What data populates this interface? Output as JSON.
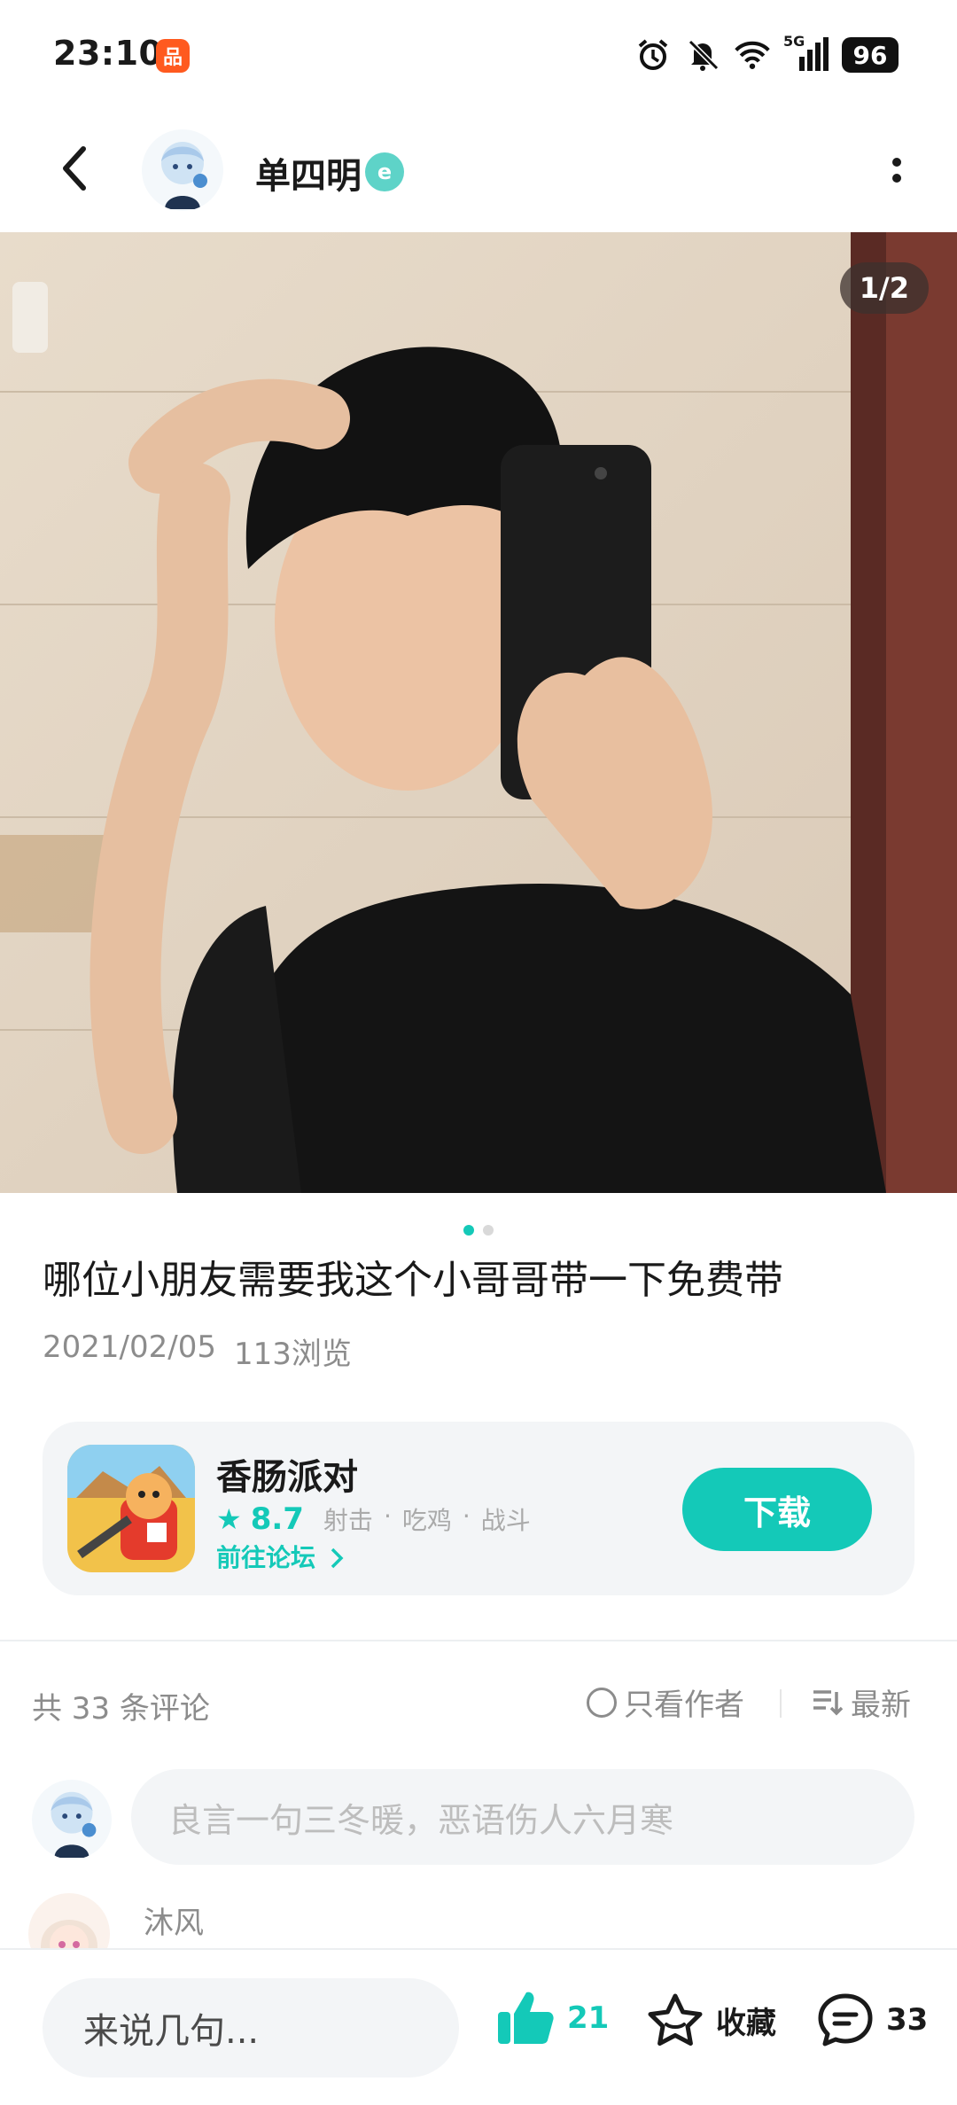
{
  "status_bar": {
    "time": "23:10",
    "app_badge": "品",
    "battery": "96",
    "network": "5G",
    "icons": [
      "alarm-icon",
      "mute-icon",
      "wifi-icon",
      "signal-icon",
      "battery-icon"
    ]
  },
  "header": {
    "username": "单四明",
    "verified_badge": "e"
  },
  "post": {
    "image_counter": "1/2",
    "image_count": 2,
    "active_image_index": 0,
    "title": "哪位小朋友需要我这个小哥哥带一下免费带",
    "date": "2021/02/05",
    "views": "113浏览"
  },
  "game_card": {
    "name": "香肠派对",
    "rating": "8.7",
    "tags": [
      "射击",
      "·",
      "吃鸡",
      "·",
      "战斗"
    ],
    "forum_link": "前往论坛",
    "download_label": "下载"
  },
  "comments": {
    "count_label": "共 33 条评论",
    "only_author_label": "只看作者",
    "sort_label": "最新",
    "input_placeholder": "良言一句三冬暖，恶语伤人六月寒",
    "first_commenter": "沐风"
  },
  "bottom_bar": {
    "input_placeholder": "来说几句...",
    "like_count": "21",
    "favorite_label": "收藏",
    "comment_count": "33"
  },
  "colors": {
    "accent": "#14c9b8",
    "card_bg": "#f3f5f7",
    "muted_text": "#8c8c8c"
  }
}
